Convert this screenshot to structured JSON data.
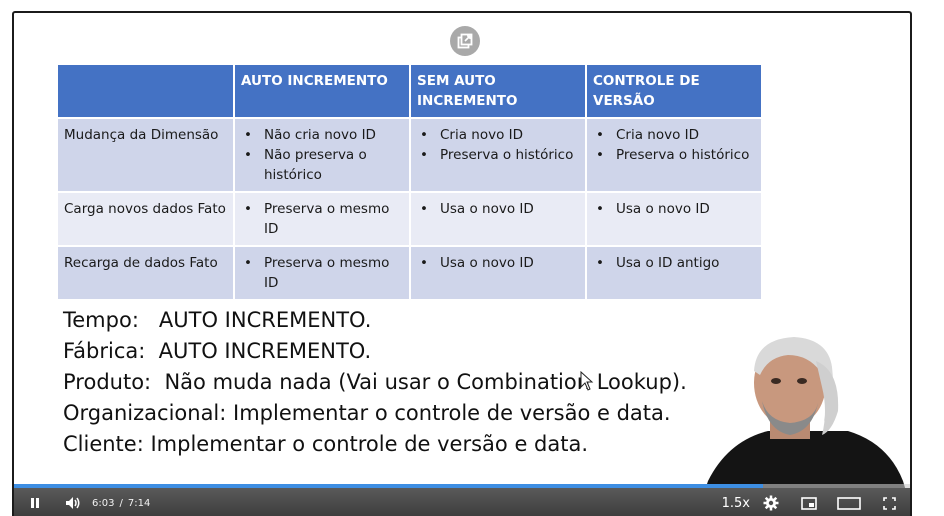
{
  "table": {
    "headers": [
      "",
      "AUTO INCREMENTO",
      "SEM AUTO INCREMENTO",
      "CONTROLE DE VERSÃO"
    ],
    "rows": [
      {
        "label": "Mudança da Dimensão",
        "auto": [
          "Não cria novo ID",
          "Não preserva o histórico"
        ],
        "sem_auto": [
          "Cria novo ID",
          "Preserva o histórico"
        ],
        "controle": [
          "Cria novo ID",
          "Preserva o histórico"
        ]
      },
      {
        "label": "Carga novos dados Fato",
        "auto": [
          "Preserva o mesmo ID"
        ],
        "sem_auto": [
          "Usa o novo ID"
        ],
        "controle": [
          "Usa o novo ID"
        ]
      },
      {
        "label": "Recarga de dados Fato",
        "auto": [
          "Preserva o mesmo ID"
        ],
        "sem_auto": [
          "Usa o novo ID"
        ],
        "controle": [
          "Usa o ID antigo"
        ]
      }
    ]
  },
  "notes": [
    "Tempo:   AUTO INCREMENTO.",
    "Fábrica:  AUTO INCREMENTO.",
    "Produto:  Não muda nada (Vai usar o Combination Lookup).",
    "Organizacional: Implementar o controle de versão e data.",
    "Cliente: Implementar o controle de versão e data."
  ],
  "player": {
    "current_time": "6:03",
    "separator": "/",
    "duration": "7:14",
    "speed": "1.5x",
    "progress_fraction": 0.836
  },
  "icons": {
    "popout": "popout-icon",
    "pause": "pause-icon",
    "volume": "volume-icon",
    "settings": "gear-icon",
    "miniplayer": "miniplayer-icon",
    "theater": "theater-mode-icon",
    "fullscreen": "fullscreen-icon"
  },
  "colors": {
    "header_blue": "#4472c4",
    "row_dark": "#cfd5ea",
    "row_light": "#e9ebf5",
    "progress": "#3d8ee3"
  }
}
